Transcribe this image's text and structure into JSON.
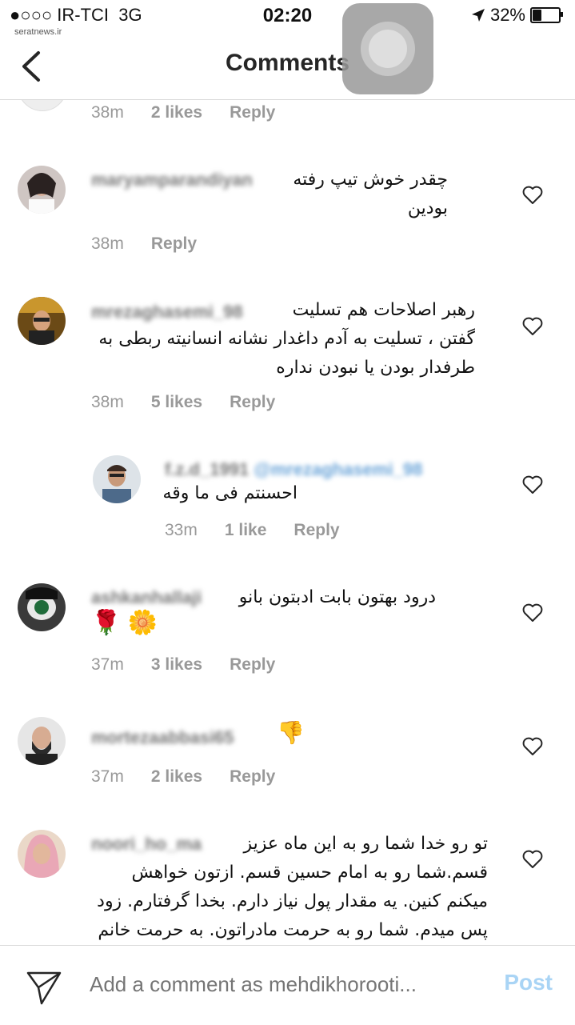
{
  "status": {
    "carrier": "●○○○ IR-TCI",
    "network": "3G",
    "time": "02:20",
    "battery": "32%",
    "battery_level": 0.32
  },
  "watermark": "seratnews.ir",
  "header": {
    "title": "Comments"
  },
  "partial": {
    "time": "38m",
    "likes": "2 likes",
    "reply": "Reply"
  },
  "comments": [
    {
      "user": "maryamparandiyan",
      "text_lines": [
        "چقدر خوش تیپ رفته",
        "بودین"
      ],
      "time": "38m",
      "likes": "",
      "reply": "Reply"
    },
    {
      "user": "mrezaghasemi_98",
      "text_lines": [
        "رهبر اصلاحات هم تسلیت",
        "گفتن ، تسلیت به آدم داغدار نشانه انسانیته ربطی به",
        "طرفدار بودن یا نبودن نداره"
      ],
      "time": "38m",
      "likes": "5 likes",
      "reply": "Reply"
    },
    {
      "user": "f.z.d_1991",
      "mention": "@mrezaghasemi_98",
      "text_lines": [
        "احسنتم فی ما وقه"
      ],
      "time": "33m",
      "likes": "1 like",
      "reply": "Reply"
    },
    {
      "user": "ashkanhallaji",
      "text_lines": [
        "درود بهتون بابت ادبتون بانو"
      ],
      "emoji": "🌹 🌼",
      "time": "37m",
      "likes": "3 likes",
      "reply": "Reply"
    },
    {
      "user": "mortezaabbasi65",
      "emoji": "👎",
      "time": "37m",
      "likes": "2 likes",
      "reply": "Reply"
    },
    {
      "user": "noori_ho_ma",
      "text_lines": [
        "تو رو خدا شما رو به این ماه عزیز",
        "قسم.شما رو به امام حسین قسم. ازتون خواهش",
        "میکنم کنین. یه مقدار پول نیاز دارم. بخدا گرفتارم. زود",
        "پس میدم. شما رو به حرمت مادراتون. به حرمت خانم"
      ]
    }
  ],
  "composer": {
    "placeholder": "Add a comment as mehdikhorooti...",
    "post": "Post"
  },
  "icons": {
    "back": "chevron-left-icon",
    "heart": "heart-outline-icon",
    "send": "send-icon",
    "location": "location-arrow-icon"
  }
}
